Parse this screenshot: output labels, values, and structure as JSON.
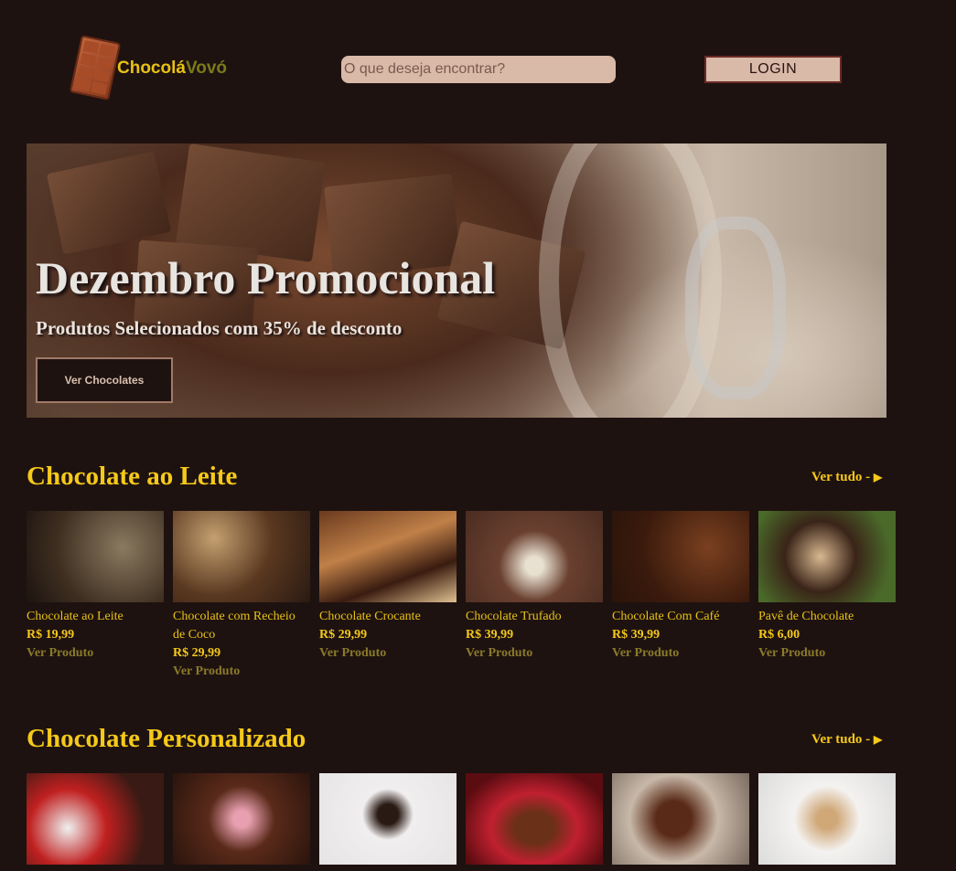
{
  "header": {
    "logo_part1": "Chocolá",
    "logo_part2": "Vovó",
    "search_placeholder": "O que deseja encontrar?",
    "login_label": "LOGIN"
  },
  "banner": {
    "title": "Dezembro Promocional",
    "subtitle": "Produtos Selecionados com 35% de desconto",
    "cta_label": "Ver Chocolates"
  },
  "sections": [
    {
      "title": "Chocolate ao Leite",
      "see_all": "Ver tudo -",
      "products": [
        {
          "name": "Chocolate ao Leite",
          "price": "R$ 19,99",
          "action": "Ver Produto"
        },
        {
          "name": "Chocolate com Recheio de Coco",
          "price": "R$ 29,99",
          "action": "Ver Produto"
        },
        {
          "name": "Chocolate Crocante",
          "price": "R$ 29,99",
          "action": "Ver Produto"
        },
        {
          "name": "Chocolate Trufado",
          "price": "R$ 39,99",
          "action": "Ver Produto"
        },
        {
          "name": "Chocolate Com Café",
          "price": "R$ 39,99",
          "action": "Ver Produto"
        },
        {
          "name": "Pavê de Chocolate",
          "price": "R$ 6,00",
          "action": "Ver Produto"
        }
      ]
    },
    {
      "title": "Chocolate Personalizado",
      "see_all": "Ver tudo -"
    }
  ],
  "colors": {
    "background": "#1e1210",
    "accent_yellow": "#f5c91a",
    "muted_link": "#8a7a2a",
    "input_bg": "#d9b9a8"
  }
}
